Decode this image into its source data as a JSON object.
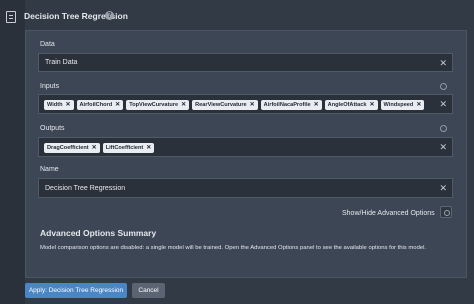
{
  "header": {
    "title": "Decision Tree Regression",
    "help_icon": "help-circle-icon"
  },
  "sidebar": {
    "icon": "document-icon"
  },
  "data_field": {
    "label": "Data",
    "value": "Train Data"
  },
  "inputs_field": {
    "label": "Inputs",
    "chips": [
      "Width",
      "AirfoilChord",
      "TopViewCurvature",
      "RearViewCurvature",
      "AirfoilNacaProfile",
      "AngleOfAttack",
      "Windspeed"
    ]
  },
  "outputs_field": {
    "label": "Outputs",
    "chips": [
      "DragCoefficient",
      "LiftCoefficient"
    ]
  },
  "name_field": {
    "label": "Name",
    "value": "Decision Tree Regression"
  },
  "advanced": {
    "toggle_label": "Show/Hide Advanced Options"
  },
  "summary": {
    "title": "Advanced Options Summary",
    "text": "Model comparison options are disabled: a single model will be trained. Open the Advanced Options panel to see the available options for this model."
  },
  "footer": {
    "apply_label": "Apply: Decision Tree Regression",
    "cancel_label": "Cancel"
  },
  "colors": {
    "accent": "#4a86c5",
    "background": "#323a45",
    "panel": "#3c4654",
    "field": "#2a313b"
  }
}
